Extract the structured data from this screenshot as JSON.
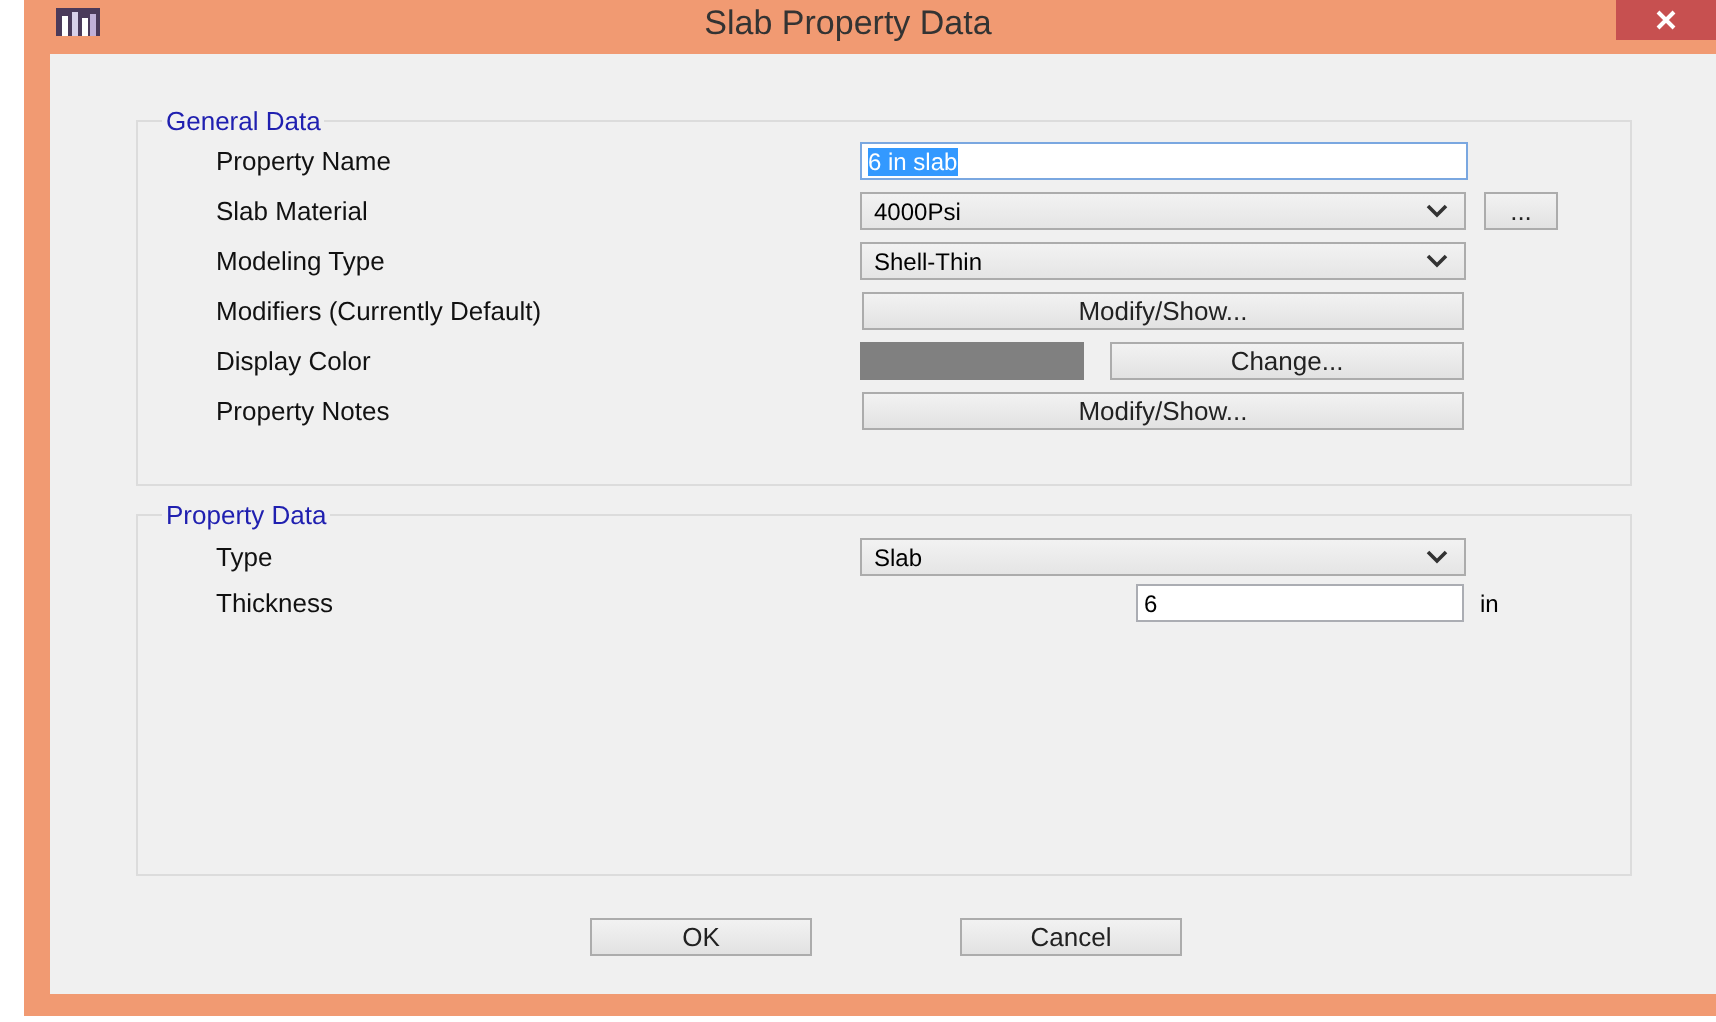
{
  "window": {
    "title": "Slab Property Data"
  },
  "general_data": {
    "title": "General Data",
    "rows": [
      {
        "kind": "text",
        "label": "Property Name",
        "value": "6 in slab",
        "highlighted": true
      },
      {
        "kind": "dropdown",
        "label": "Slab Material",
        "value": "4000Psi",
        "button": "..."
      },
      {
        "kind": "dropdown",
        "label": "Modeling Type",
        "value": "Shell-Thin"
      },
      {
        "kind": "button",
        "label": "Modifiers (Currently Default)",
        "button": "Modify/Show..."
      },
      {
        "kind": "color",
        "label": "Display Color",
        "color": "#808080",
        "button": "Change..."
      },
      {
        "kind": "button",
        "label": "Property Notes",
        "button": "Modify/Show..."
      }
    ]
  },
  "property_data": {
    "title": "Property Data",
    "rows": [
      {
        "kind": "dropdown",
        "label": "Type",
        "value": "Slab"
      },
      {
        "kind": "number",
        "label": "Thickness",
        "value": "6",
        "unit": "in"
      }
    ]
  },
  "buttons": [
    "OK",
    "Cancel"
  ]
}
